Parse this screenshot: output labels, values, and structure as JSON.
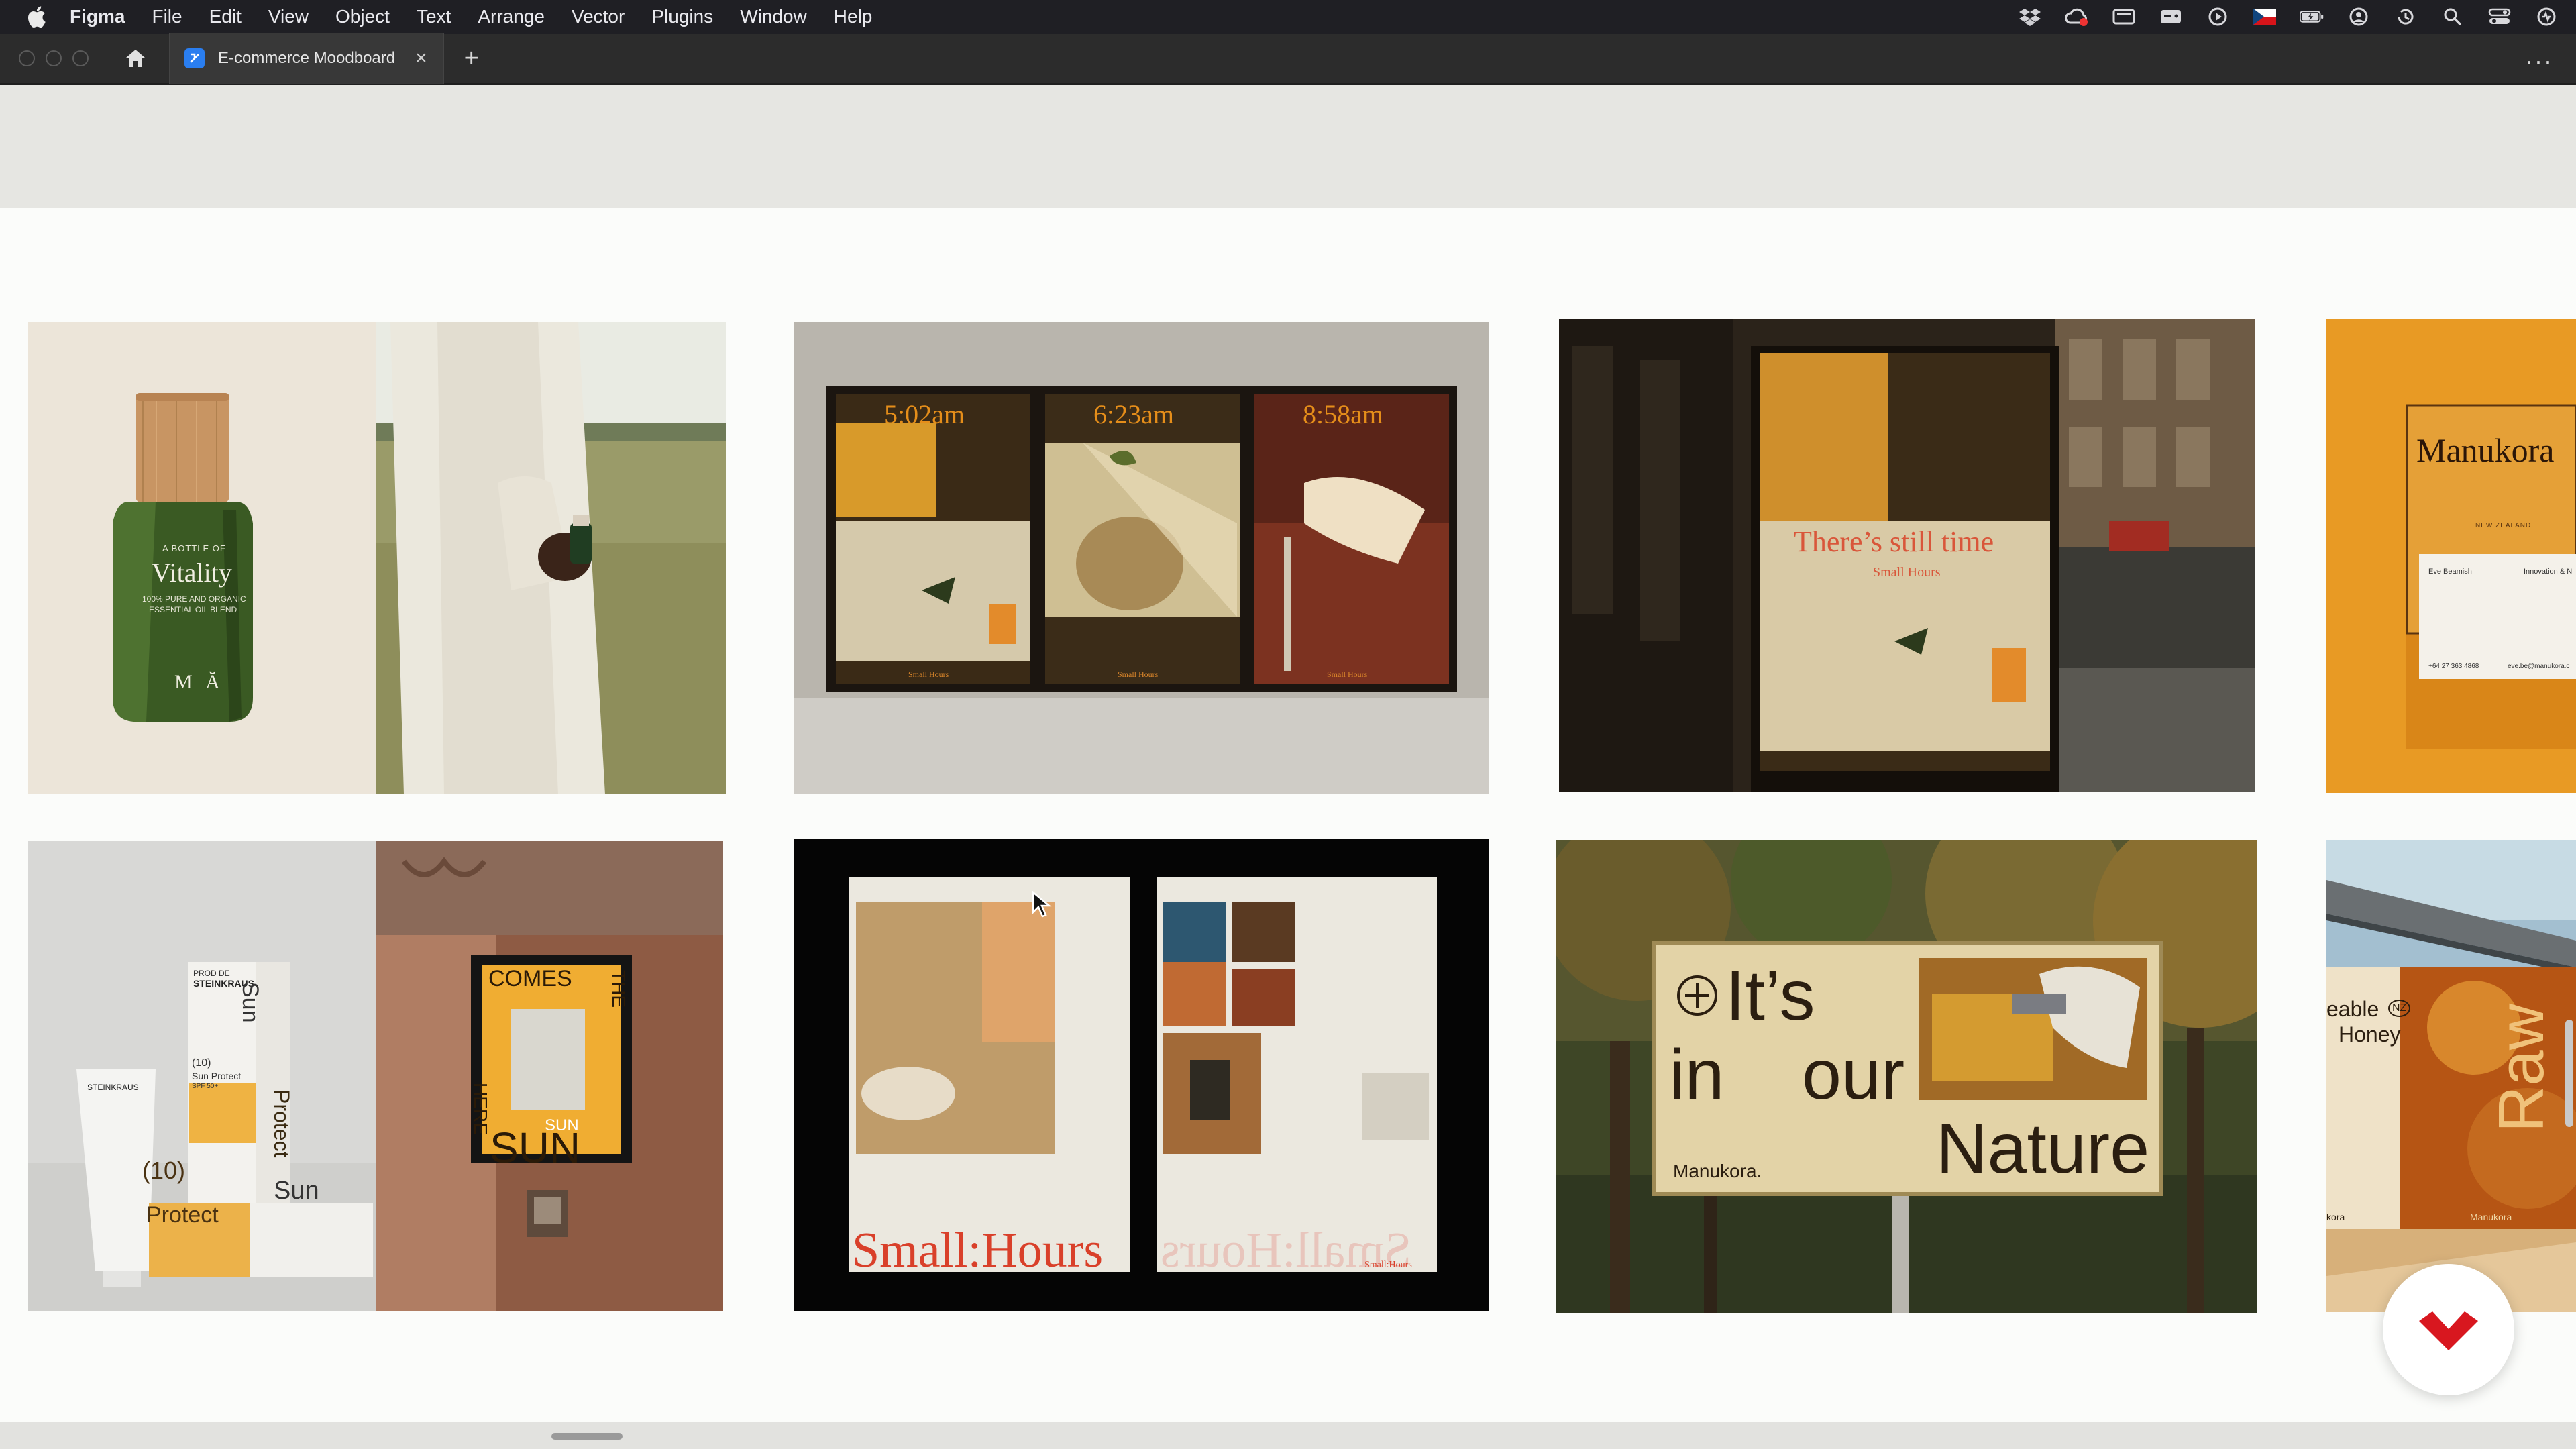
{
  "menubar": {
    "app_name": "Figma",
    "items": [
      "File",
      "Edit",
      "View",
      "Object",
      "Text",
      "Arrange",
      "Vector",
      "Plugins",
      "Window",
      "Help"
    ],
    "status_icons": [
      "dropbox-icon",
      "creative-cloud-icon",
      "display-icon",
      "gamepad-icon",
      "play-icon",
      "flag-cz-icon",
      "battery-icon",
      "user-icon",
      "time-machine-icon",
      "search-icon",
      "control-center-icon",
      "siri-icon"
    ]
  },
  "tabbar": {
    "tab_title": "E-commerce Moodboard",
    "close_glyph": "×",
    "new_tab_glyph": "+",
    "more_glyph": "···"
  },
  "cards": {
    "vitality": {
      "small": "A BOTTLE OF",
      "brand": "Vitality",
      "line1": "100% PURE AND ORGANIC",
      "line2": "ESSENTIAL OIL BLEND",
      "mark": "M Ă"
    },
    "posters": {
      "t1": "5:02am",
      "t2": "6:23am",
      "t3": "8:58am",
      "foot": "Small Hours"
    },
    "billboard": {
      "headline": "There’s still time",
      "sub": "Small Hours"
    },
    "manukora_card": {
      "brand": "Manukora",
      "country": "NEW ZEALAND",
      "name": "Eve Beamish",
      "role": "Innovation & N",
      "phone": "+64 27 363 4868",
      "web": "eve.be@manukora.c"
    },
    "sun": {
      "prod_label": "PROD DE",
      "maker": "STEINKRAUS",
      "num": "(10)",
      "name": "Sun Protect",
      "spf": "SPF 50+",
      "vertical": "Protect",
      "sun": "Sun",
      "protect": "Protect",
      "poster_comes": "COMES",
      "poster_the": "THE",
      "poster_here": "HERE",
      "poster_sun": "SUN",
      "poster_big": "SUN"
    },
    "smallhours_book": {
      "title": "Small:Hours",
      "mirror": "Small:Hours",
      "small_sig": "Small:Hours"
    },
    "nature": {
      "its": "It’s",
      "in": "in",
      "our": "our",
      "nature": "Nature",
      "brand": "Manukora."
    },
    "honey": {
      "frag1": "eable",
      "badge": "NZ",
      "frag2": "Honey",
      "raw": "Raw",
      "brand": "Manukora",
      "edge": "kora"
    }
  },
  "colors": {
    "menubar_bg": "#1f1f24",
    "tabbar_bg": "#2c2c2c",
    "canvas_bg": "#fbfcfa",
    "band_bg": "#e6e6e2",
    "accent_orange": "#e58e1a",
    "accent_red": "#d9402a",
    "fab_red": "#d8171f"
  }
}
